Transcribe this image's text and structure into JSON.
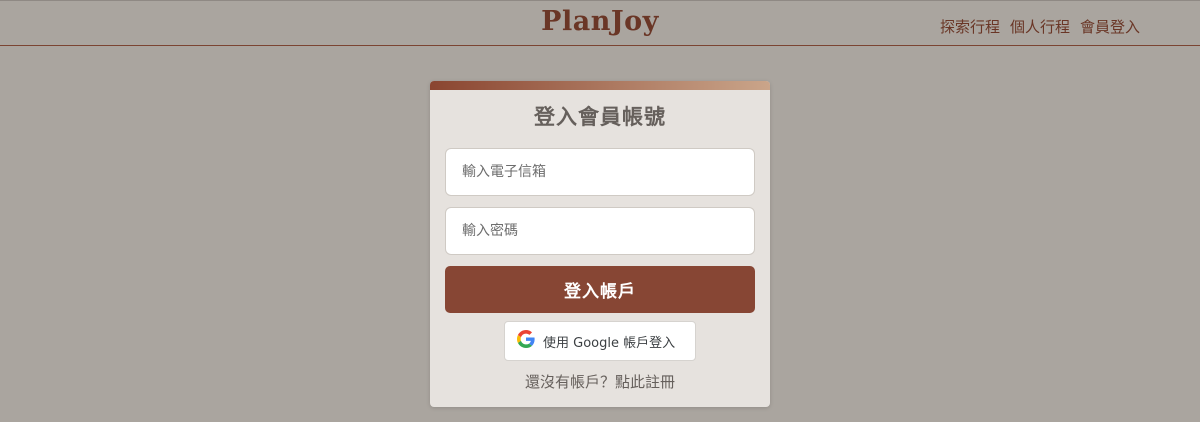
{
  "header": {
    "brand": "PlanJoy",
    "nav": [
      "探索行程",
      "個人行程",
      "會員登入"
    ]
  },
  "background": {
    "title": "PlanJoy"
  },
  "login_modal": {
    "title": "登入會員帳號",
    "email_placeholder": "輸入電子信箱",
    "email_value": "",
    "password_placeholder": "輸入密碼",
    "password_value": "",
    "login_button": "登入帳戶",
    "google_button": "使用 Google 帳戶登入",
    "register_link": "還沒有帳戶？點此註冊"
  },
  "colors": {
    "background": "#aaa59f",
    "brand": "#6a3626",
    "primary_button": "#874634",
    "modal_bg": "#e6e2de"
  },
  "icons": {
    "google": "google-g-icon"
  }
}
